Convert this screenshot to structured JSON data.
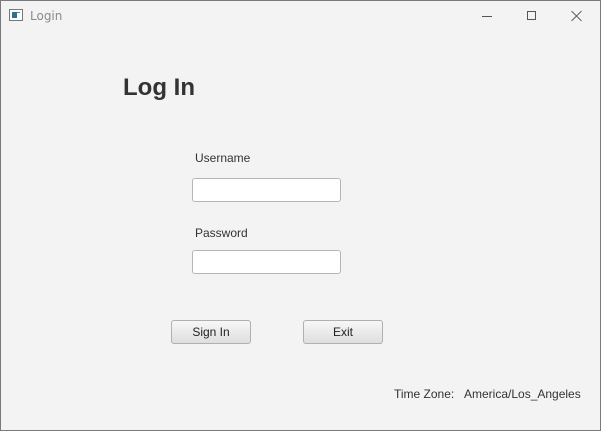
{
  "window": {
    "title": "Login",
    "controls": [
      "minimize",
      "maximize",
      "close"
    ]
  },
  "form": {
    "heading": "Log In",
    "username_label": "Username",
    "username_value": "",
    "password_label": "Password",
    "password_value": "",
    "sign_in_label": "Sign In",
    "exit_label": "Exit"
  },
  "footer": {
    "timezone_label": "Time Zone:",
    "timezone_value": "America/Los_Angeles"
  },
  "icons": {
    "app": "app-window-icon",
    "minimize": "minimize-icon",
    "maximize": "maximize-icon",
    "close": "close-icon"
  },
  "colors": {
    "background": "#f3f3f3",
    "text": "#333333",
    "field_background": "#ffffff",
    "field_border": "#b5b5b5",
    "button_border": "#b0b0b0"
  }
}
